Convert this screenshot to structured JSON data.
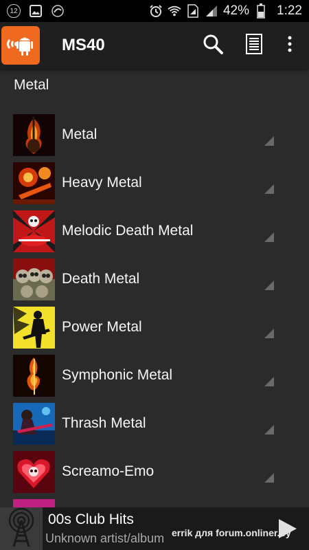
{
  "status_bar": {
    "notification_count": "12",
    "battery": "42%",
    "time": "1:22",
    "icons": [
      "notification-badge",
      "image-icon",
      "app-notification-icon",
      "alarm-icon",
      "wifi-icon",
      "sim-icon",
      "signal-icon",
      "battery-icon"
    ]
  },
  "app_bar": {
    "title": "MS40",
    "logo_icon": "android-radio-icon",
    "actions": [
      "search-icon",
      "list-view-icon",
      "overflow-menu-icon"
    ],
    "logo_color": "#ef6a1f"
  },
  "category": {
    "title": "Metal"
  },
  "stations": [
    {
      "name": "Metal",
      "thumb_icon": "flaming-guitar"
    },
    {
      "name": "Heavy Metal",
      "thumb_icon": "fiery-skeleton-guitarist"
    },
    {
      "name": "Melodic Death Metal",
      "thumb_icon": "skull-red-guitar"
    },
    {
      "name": "Death Metal",
      "thumb_icon": "skulls-pile"
    },
    {
      "name": "Power Metal",
      "thumb_icon": "yellow-guitarist-silhouette"
    },
    {
      "name": "Symphonic Metal",
      "thumb_icon": "flaming-treble-clef"
    },
    {
      "name": "Thrash Metal",
      "thumb_icon": "blue-guitarist"
    },
    {
      "name": "Screamo-Emo",
      "thumb_icon": "red-heart-skull"
    }
  ],
  "player": {
    "title": "00s Club Hits",
    "subtitle": "Unknown artist/album",
    "art_icon": "radio-tower-icon",
    "play_icon": "play-icon"
  },
  "watermark": "errik для forum.onliner.by",
  "colors": {
    "background": "#2b2b2b",
    "app_bar": "#1f1f1f",
    "status_bar": "#000000",
    "player_bar": "#1a1a1a",
    "accent": "#ef6a1f"
  }
}
